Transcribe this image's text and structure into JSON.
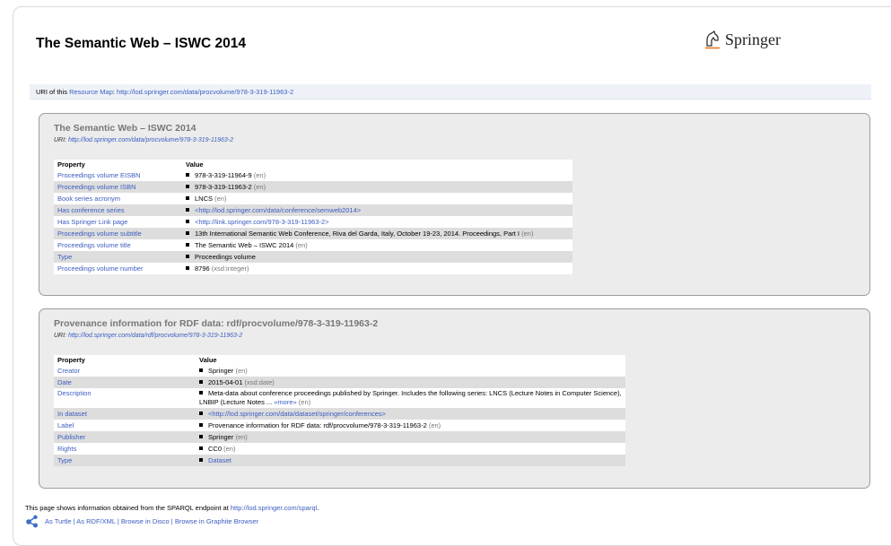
{
  "header": {
    "title": "The Semantic Web – ISWC 2014",
    "logo_text": "Springer"
  },
  "resource_map": {
    "prefix": "URI of this ",
    "link_label": "Resource Map",
    "separator": ": ",
    "uri": "http://lod.springer.com/data/procvolume/978-3-319-11963-2"
  },
  "box1": {
    "title": "The Semantic Web – ISWC 2014",
    "uri_label": "URI: ",
    "uri": "http://lod.springer.com/data/procvolume/978-3-319-11963-2",
    "col_property": "Property",
    "col_value": "Value",
    "rows": [
      {
        "property": "Proceedings volume EISBN",
        "value": "978-3-319-11964-9",
        "suffix": " (en)"
      },
      {
        "property": "Proceedings volume ISBN",
        "value": "978-3-319-11963-2",
        "suffix": " (en)"
      },
      {
        "property": "Book series acronym",
        "value": "LNCS",
        "suffix": " (en)"
      },
      {
        "property": "Has conference series",
        "value": "<http://lod.springer.com/data/conference/semweb2014>",
        "suffix": ""
      },
      {
        "property": "Has Springer Link page",
        "value": "<http://link.springer.com/978-3-319-11963-2>",
        "suffix": ""
      },
      {
        "property": "Proceedings volume subtitle",
        "value": "13th International Semantic Web Conference, Riva del Garda, Italy, October 19-23, 2014. Proceedings, Part I",
        "suffix": " (en)"
      },
      {
        "property": "Proceedings volume title",
        "value": "The Semantic Web – ISWC 2014",
        "suffix": " (en)"
      },
      {
        "property": "Type",
        "value": "Proceedings volume",
        "suffix": ""
      },
      {
        "property": "Proceedings volume number",
        "value": "8796",
        "suffix": " (xsd:integer)"
      }
    ]
  },
  "box2": {
    "title": "Provenance information for RDF data: rdf/procvolume/978-3-319-11963-2",
    "uri_label": "URI: ",
    "uri": "http://lod.springer.com/data/rdf/procvolume/978-3-319-11963-2",
    "col_property": "Property",
    "col_value": "Value",
    "rows": [
      {
        "property": "Creator",
        "value": "Springer",
        "suffix": " (en)"
      },
      {
        "property": "Date",
        "value": "2015-04-01",
        "suffix": " (xsd:date)"
      },
      {
        "property": "Description",
        "value": "Meta-data about conference proceedings published by Springer. Includes the following series: LNCS (Lecture Notes in Computer Science), LNBIP (Lecture Notes",
        "more_dots": " ... ",
        "more": "»more»",
        "suffix": " (en)"
      },
      {
        "property": "In dataset",
        "value": "<http://lod.springer.com/data/dataset/springer/conferences>",
        "suffix": ""
      },
      {
        "property": "Label",
        "value": "Provenance information for RDF data: rdf/procvolume/978-3-319-11963-2",
        "suffix": " (en)"
      },
      {
        "property": "Publisher",
        "value": "Springer",
        "suffix": " (en)"
      },
      {
        "property": "Rights",
        "value": "CC0",
        "suffix": " (en)"
      },
      {
        "property": "Type",
        "value": "Dataset",
        "suffix": ""
      }
    ]
  },
  "footer": {
    "text": "This page shows information obtained from the SPARQL endpoint at ",
    "endpoint": "http://lod.springer.com/sparql",
    "end": ".",
    "links": [
      "As Turtle",
      "As RDF/XML",
      "Browse in Disco",
      "Browse in Graphite Browser"
    ],
    "separator": " | "
  }
}
